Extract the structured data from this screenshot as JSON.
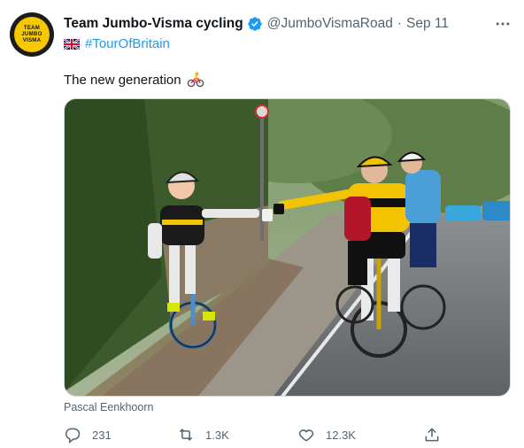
{
  "tweet": {
    "display_name": "Team Jumbo-Visma cycling",
    "handle": "@JumboVismaRoad",
    "separator": "·",
    "date": "Sep 11",
    "hashtag": "#TourOfBritain",
    "text": "The new generation",
    "photo_credit": "Pascal Eenkhoorn",
    "avatar_text": [
      "TEAM",
      "JUMBO",
      "VISMA"
    ],
    "icons": {
      "verified": "verified-badge-icon",
      "more": "more-options-icon",
      "flag": "uk-flag-icon",
      "emoji": "cyclist-emoji-icon"
    }
  },
  "actions": {
    "replies": "231",
    "retweets": "1.3K",
    "likes": "12.3K"
  },
  "colors": {
    "accent": "#1d9bf0",
    "secondary_text": "#536471",
    "brand_yellow": "#f6c800"
  }
}
